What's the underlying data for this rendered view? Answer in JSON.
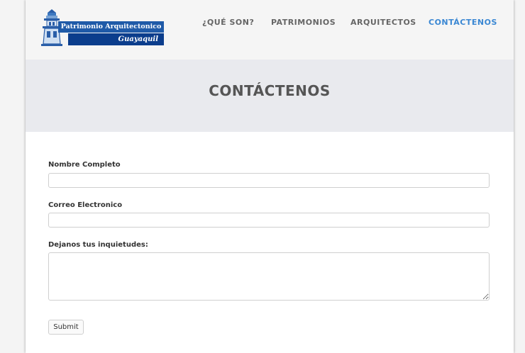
{
  "header": {
    "logo": {
      "line1": "Patrimonio Arquitectonico",
      "line2": "Guayaquil"
    },
    "nav": [
      {
        "label": "¿QUÉ SON?",
        "active": false
      },
      {
        "label": "PATRIMONIOS",
        "active": false
      },
      {
        "label": "ARQUITECTOS",
        "active": false
      },
      {
        "label": "CONTÁCTENOS",
        "active": true
      }
    ]
  },
  "page": {
    "title": "CONTÁCTENOS"
  },
  "form": {
    "name_label": "Nombre Completo",
    "name_value": "",
    "email_label": "Correo Electronico",
    "email_value": "",
    "message_label": "Dejanos tus inquietudes:",
    "message_value": "",
    "submit_label": "Submit"
  },
  "colors": {
    "nav_active": "#3a87d3",
    "nav_inactive": "#666666",
    "header_band": "#e9eaee",
    "logo_blue": "#1f5aa8"
  },
  "icons": [
    "lighthouse-logo-icon",
    "resize-handle-icon"
  ]
}
